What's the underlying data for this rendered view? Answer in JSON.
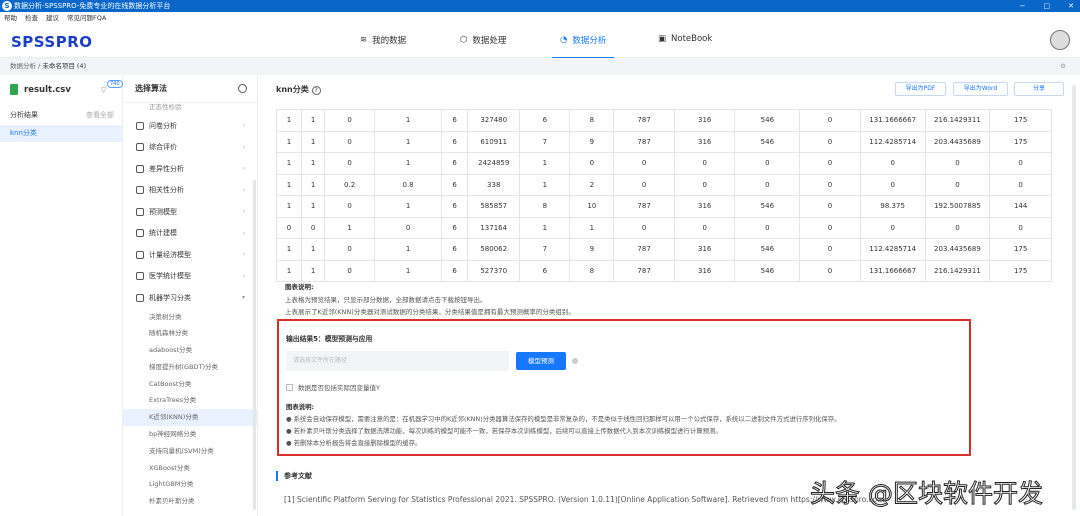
{
  "window": {
    "title": "数据分析-SPSSPRO-免费专业的在线数据分析平台",
    "logo": "S",
    "controls": [
      "−",
      "□",
      "✕"
    ]
  },
  "menu": [
    "帮助",
    "检查",
    "建议",
    "常见问题FQA"
  ],
  "header": {
    "brand": "SPSSPRO",
    "tabs": [
      {
        "label": "我的数据"
      },
      {
        "label": "数据处理"
      },
      {
        "label": "数据分析"
      },
      {
        "label": "NoteBook"
      }
    ]
  },
  "breadcrumb": {
    "root": "数据分析",
    "sep": " / ",
    "current": "未命名项目 (4)"
  },
  "left": {
    "file": "result.csv",
    "badge": "740",
    "results_label": "分析结果",
    "view_all": "查看全部",
    "selected": "knn分类"
  },
  "algo": {
    "title": "选择算法",
    "partial": "正态性检验",
    "categories": [
      "问卷分析",
      "综合评价",
      "差异性分析",
      "相关性分析",
      "预测模型",
      "统计建模",
      "计量经济模型",
      "医学统计模型",
      "机器学习分类"
    ],
    "subs": [
      "决策树分类",
      "随机森林分类",
      "adaboost分类",
      "梯度提升树(GBDT)分类",
      "CatBoost分类",
      "ExtraTrees分类",
      "K近邻(KNN)分类",
      "bp神经网络分类",
      "支持向量机(SVM)分类",
      "XGBoost分类",
      "LightGBM分类",
      "朴素贝叶斯分类"
    ]
  },
  "main": {
    "title": "knn分类",
    "help": "?",
    "export_pdf": "导出为PDF",
    "export_word": "导出为Word",
    "share": "分享"
  },
  "table": {
    "rows": [
      [
        "1",
        "1",
        "0",
        "1",
        "6",
        "327480",
        "6",
        "8",
        "787",
        "316",
        "546",
        "0",
        "131.1666667",
        "216.1429311",
        "175"
      ],
      [
        "1",
        "1",
        "0",
        "1",
        "6",
        "610911",
        "7",
        "9",
        "787",
        "316",
        "546",
        "0",
        "112.4285714",
        "203.4435689",
        "175"
      ],
      [
        "1",
        "1",
        "0",
        "1",
        "6",
        "2424859",
        "1",
        "0",
        "0",
        "0",
        "0",
        "0",
        "0",
        "0",
        "0"
      ],
      [
        "1",
        "1",
        "0.2",
        "0.8",
        "6",
        "338",
        "1",
        "2",
        "0",
        "0",
        "0",
        "0",
        "0",
        "0",
        "0"
      ],
      [
        "1",
        "1",
        "0",
        "1",
        "6",
        "585857",
        "8",
        "10",
        "787",
        "316",
        "546",
        "0",
        "98.375",
        "192.5007885",
        "144"
      ],
      [
        "0",
        "0",
        "1",
        "0",
        "6",
        "137164",
        "1",
        "1",
        "0",
        "0",
        "0",
        "0",
        "0",
        "0",
        "0"
      ],
      [
        "1",
        "1",
        "0",
        "1",
        "6",
        "580062",
        "7",
        "9",
        "787",
        "316",
        "546",
        "0",
        "112.4285714",
        "203.4435689",
        "175"
      ],
      [
        "1",
        "1",
        "0",
        "1",
        "6",
        "527370",
        "6",
        "8",
        "787",
        "316",
        "546",
        "0",
        "131.1666667",
        "216.1429311",
        "175"
      ]
    ]
  },
  "notes": {
    "heading": "图表说明:",
    "lines": [
      "上表格为预览结果，只显示部分数据，全部数据请点击下载按钮导出。",
      "上表展示了K近邻(KNN)分类器对测试数据的分类结果，分类结果值是拥有最大预测概率的分类组别。"
    ]
  },
  "prediction": {
    "title": "输出结果5：模型预测与应用",
    "placeholder": "请选择文件所在路径",
    "button": "模型预测",
    "checkbox": "数据是否包括实际因变量值Y",
    "heading": "图表说明:",
    "bullets": [
      "系统会自动保存模型，需要注意的是：在机器学习中的K近邻(KNN)分类器算法保存的模型是非常复杂的，不是类似于线性回归那样可以用一个公式保存，系统以二进制文件方式进行序列化保存。",
      "若朴素贝叶斯分类选择了数据洗牌功能，每次训练的模型可能不一致，若保存本次训练模型，后续可以直接上传数据代入到本次训练模型进行计算预测。",
      "若删除本分析报告将会直接删除模型的缓存。"
    ]
  },
  "refs": {
    "heading": "参考文献",
    "items": [
      "[1] Scientific Platform Serving for Statistics Professional 2021. SPSSPRO. (Version 1.0.11)[Online Application Software]. Retrieved from https://www.spsspro.com."
    ]
  },
  "watermark": "头条 @区块软件开发"
}
